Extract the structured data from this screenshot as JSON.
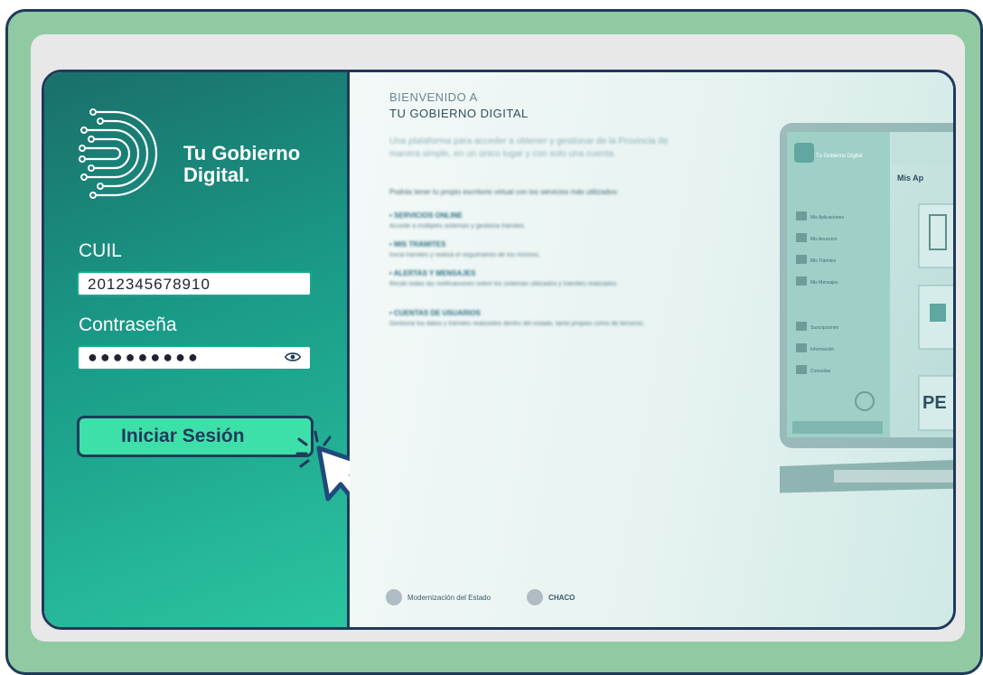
{
  "brand": {
    "line1": "Tu Gobierno",
    "line2": "Digital."
  },
  "login": {
    "cuil_label": "CUIL",
    "cuil_value": "2012345678910",
    "password_label": "Contraseña",
    "password_mask": "●●●●●●●●●",
    "submit_label": "Iniciar Sesión"
  },
  "welcome": {
    "heading_line1": "BIENVENIDO A",
    "heading_line2": "TU GOBIERNO DIGITAL",
    "paragraph": "Una plataforma para acceder a obtener y gestionar de la Provincia de manera simple, en un único lugar y con solo una cuenta.",
    "intro": "Podrás tener tu propio escritorio virtual con los servicios más utilizados:",
    "sections": [
      {
        "title": "• SERVICIOS ONLINE",
        "desc": "Accede a múltiples sistemas y gestiona trámites"
      },
      {
        "title": "• MIS TRÁMITES",
        "desc": "Iniciá trámites y realizá el seguimiento de los mismos."
      },
      {
        "title": "• ALERTAS Y MENSAJES",
        "desc": "Recibí todas las notificaciones sobre los sistemas utilizados y trámites realizados."
      },
      {
        "title": "• CUENTAS DE USUARIOS",
        "desc": "Gestioná los datos y trámites realizados dentro del estado, tanto propios como de terceros."
      }
    ]
  },
  "laptop": {
    "brand_small": "Tu Gobierno Digital",
    "tab": "Mis Ap",
    "menu": [
      "Mis Aplicaciones",
      "Mis Anuncios",
      "Mis Trámites",
      "Mis Mensajes",
      "Suscripciones",
      "Información",
      "Consultas"
    ],
    "big_text": "PE"
  },
  "footer": {
    "org1": "Modernización del Estado",
    "org2": "CHACO"
  },
  "colors": {
    "dark_border": "#1f3a5a",
    "accent": "#3ee0a9",
    "panel_green": "#1a9b88",
    "outer_green": "#91c9a2"
  }
}
